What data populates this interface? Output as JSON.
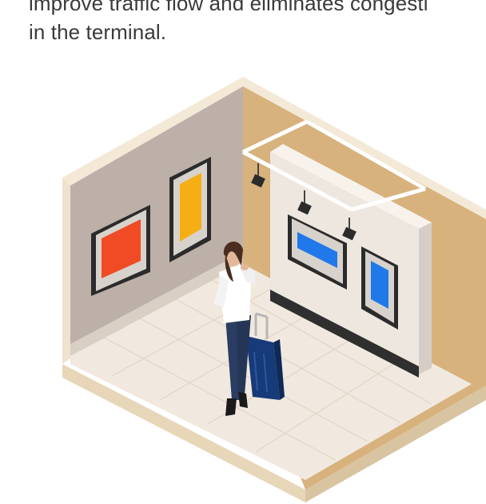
{
  "article": {
    "line1": "improve traffic flow and eliminates congesti",
    "line2": "in the terminal."
  },
  "illustration": {
    "colors": {
      "floor": "#f1e9de",
      "floor_edge": "#e6d3b6",
      "left_wall": "#bfb2aa",
      "back_wall": "#d8b582",
      "partition_front": "#efe9e2",
      "partition_side": "#ddd6cf",
      "rail": "#ffffff",
      "spotlight": "#2b2b2b",
      "frame": "#2b2b2b",
      "art_red": "#f04b25",
      "art_yellow": "#f6ae15",
      "art_blue": "#1f79e8",
      "suitcase": "#173a78",
      "jeans": "#2a3d62",
      "hair": "#4a2d1f",
      "skin": "#e4b79b",
      "shirt": "#ffffff"
    }
  }
}
